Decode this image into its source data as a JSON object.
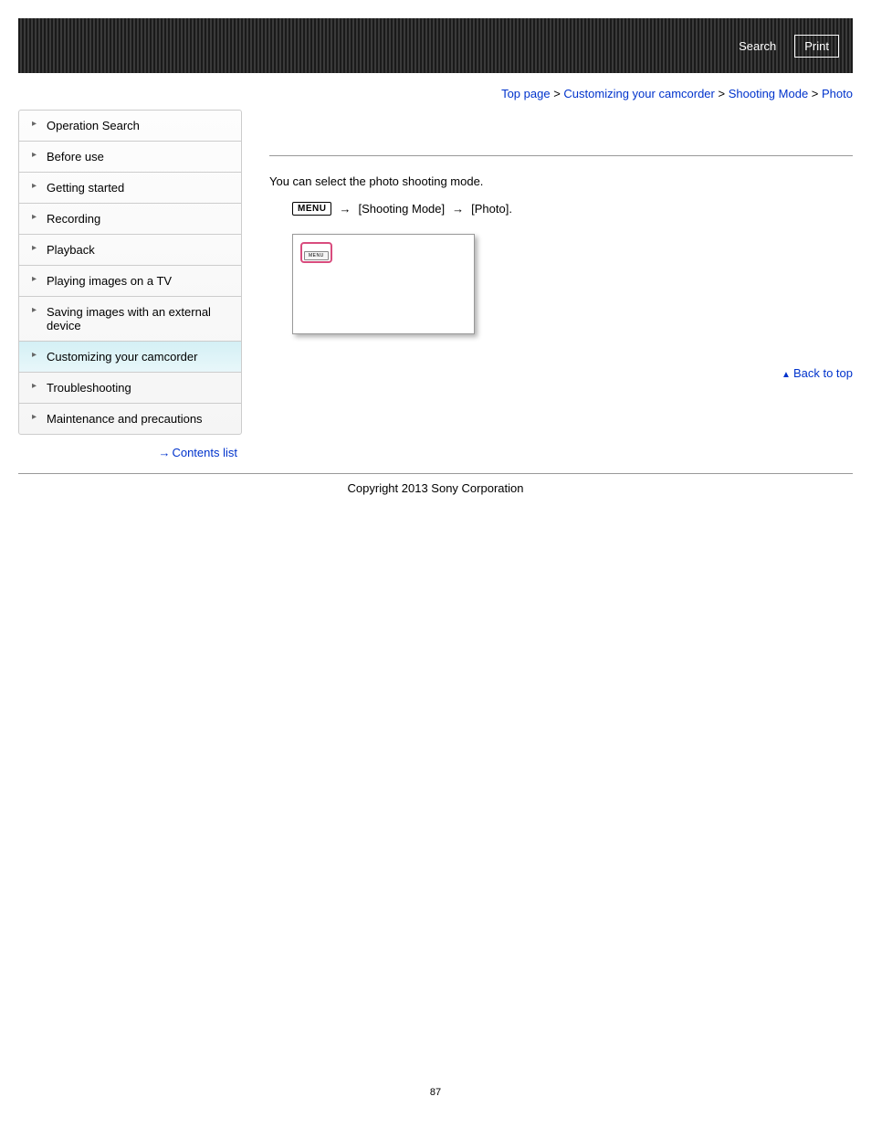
{
  "header": {
    "search": "Search",
    "print": "Print"
  },
  "breadcrumb": {
    "top_page": "Top page",
    "customizing": "Customizing your camcorder",
    "shooting_mode": "Shooting Mode",
    "photo": "Photo",
    "sep": ">"
  },
  "sidebar": {
    "items": [
      {
        "label": "Operation Search",
        "active": false
      },
      {
        "label": "Before use",
        "active": false
      },
      {
        "label": "Getting started",
        "active": false
      },
      {
        "label": "Recording",
        "active": false
      },
      {
        "label": "Playback",
        "active": false
      },
      {
        "label": "Playing images on a TV",
        "active": false
      },
      {
        "label": "Saving images with an external device",
        "active": false
      },
      {
        "label": "Customizing your camcorder",
        "active": true
      },
      {
        "label": "Troubleshooting",
        "active": false
      },
      {
        "label": "Maintenance and precautions",
        "active": false
      }
    ],
    "contents_list": "Contents list"
  },
  "main": {
    "intro": "You can select the photo shooting mode.",
    "menu_badge": "MENU",
    "path_item1": "[Shooting Mode]",
    "path_item2": "[Photo].",
    "small_menu": "MENU",
    "back_to_top": "Back to top"
  },
  "footer": {
    "copyright": "Copyright 2013 Sony Corporation",
    "page_number": "87"
  }
}
